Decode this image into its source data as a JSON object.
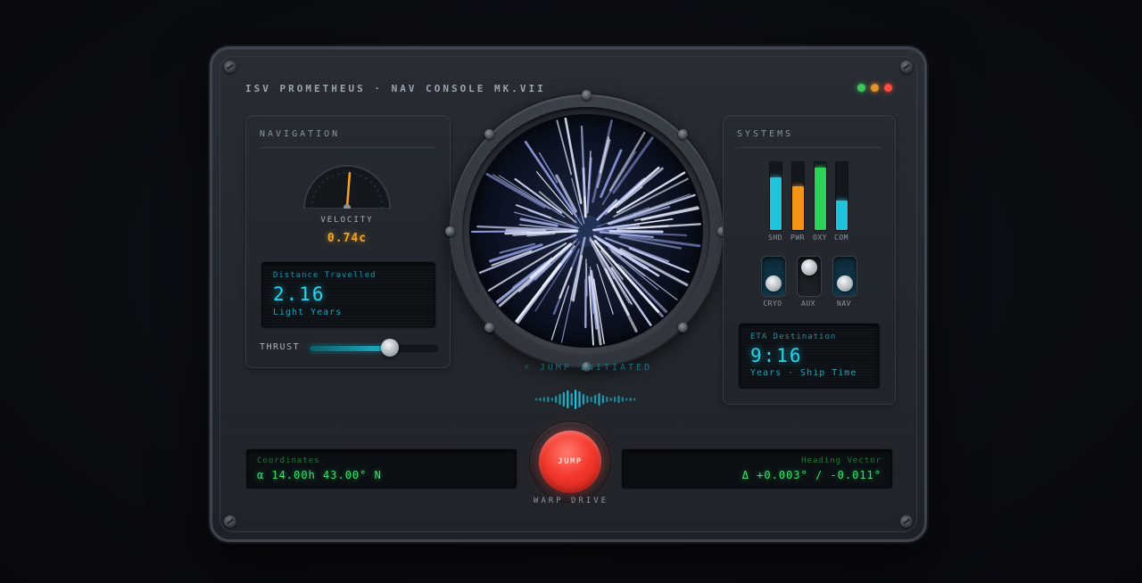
{
  "console": {
    "title": "ISV PROMETHEUS · NAV CONSOLE MK.VII",
    "status_leds": [
      "#3ec85a",
      "#e0902c",
      "#ff4a3d"
    ]
  },
  "navigation": {
    "title": "NAVIGATION",
    "velocity_label": "VELOCITY",
    "velocity_value": "0.74c",
    "velocity_fraction": 0.74,
    "distance": {
      "caption": "Distance Travelled",
      "value": "2.16",
      "unit": "Light Years"
    },
    "thrust_label": "THRUST",
    "thrust_level": 0.63
  },
  "viewport": {
    "status": "⚡ JUMP INITIATED"
  },
  "systems": {
    "title": "SYSTEMS",
    "bars": [
      {
        "label": "SHD",
        "level": 0.78,
        "color": "#1fc3dc"
      },
      {
        "label": "PWR",
        "level": 0.64,
        "color": "#f29418"
      },
      {
        "label": "OXY",
        "level": 0.92,
        "color": "#2ed158"
      },
      {
        "label": "COM",
        "level": 0.44,
        "color": "#1fc3dc"
      }
    ],
    "toggles": [
      {
        "label": "CRYO",
        "on": true
      },
      {
        "label": "AUX",
        "on": false
      },
      {
        "label": "NAV",
        "on": true
      }
    ],
    "eta": {
      "caption": "ETA Destination",
      "value": "9:16",
      "unit": "Years · Ship Time"
    }
  },
  "jump": {
    "button_label": "JUMP",
    "drive_label": "WARP DRIVE"
  },
  "coordinates": {
    "caption": "Coordinates",
    "value": "α 14.00h 43.00° N"
  },
  "heading": {
    "caption": "Heading Vector",
    "value": "Δ +0.003° / -0.011°"
  }
}
